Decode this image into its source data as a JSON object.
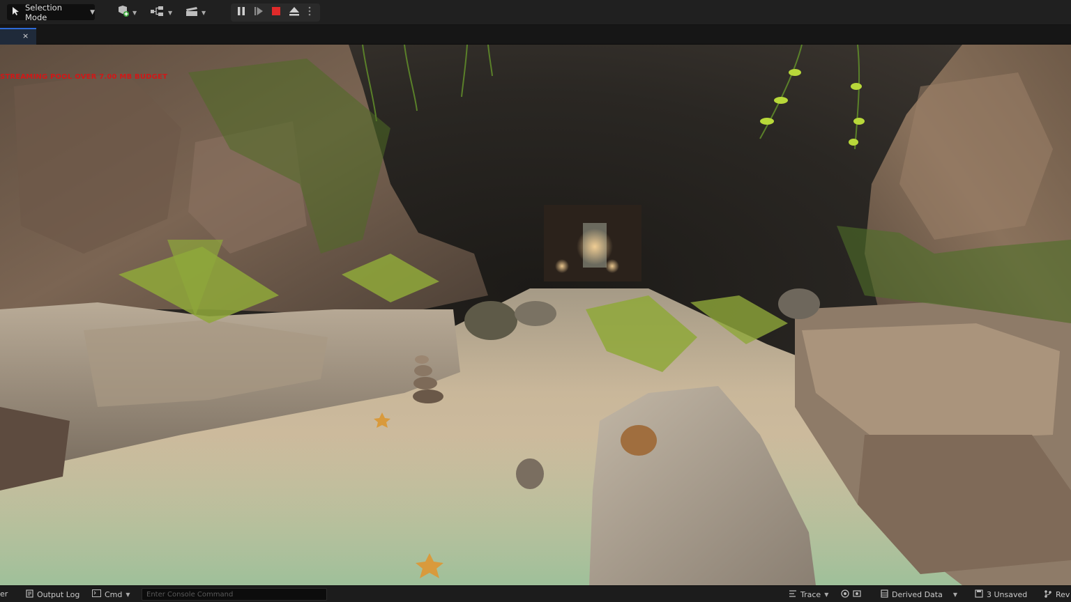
{
  "toolbar": {
    "mode_label": "Selection Mode",
    "icons": [
      "add-actor-icon",
      "blueprint-icon",
      "cinematics-icon",
      "pause-icon",
      "step-icon",
      "stop-icon",
      "eject-icon",
      "more-icon"
    ]
  },
  "tabs": {
    "close_glyph": "×"
  },
  "viewport": {
    "warning": "STREAMING POOL OVER 7.00 MB BUDGET"
  },
  "statusbar": {
    "left_cut": "er",
    "output_log": "Output Log",
    "cmd": "Cmd",
    "cmd_placeholder": "Enter Console Command",
    "trace": "Trace",
    "derived_data": "Derived Data",
    "unsaved": "3 Unsaved",
    "revision": "Rev"
  },
  "colors": {
    "toolbar_bg": "#202020",
    "stop_red": "#e02a2a",
    "tab_accent": "#2e6ad6",
    "warning_red": "#d01818"
  }
}
